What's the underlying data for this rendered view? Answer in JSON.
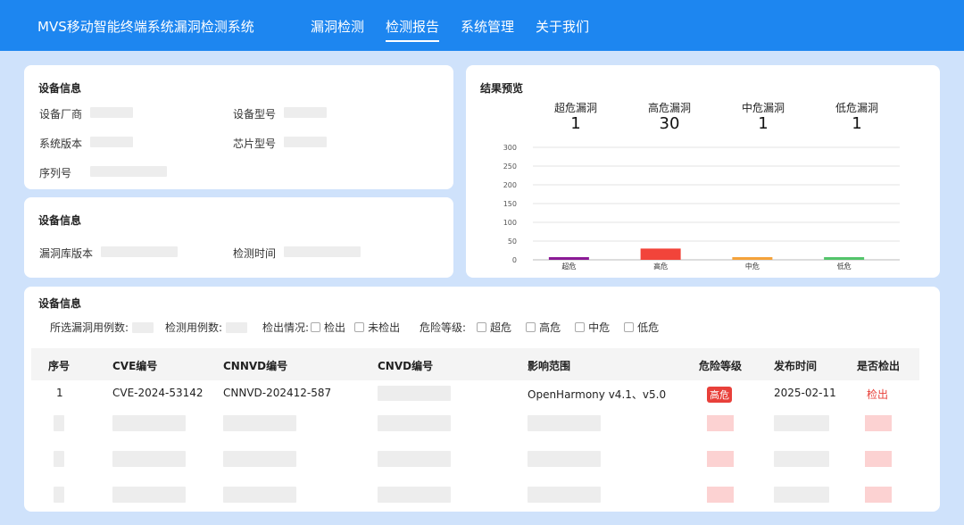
{
  "header": {
    "app_title": "MVS移动智能终端系统漏洞检测系统",
    "nav": [
      "漏洞检测",
      "检测报告",
      "系统管理",
      "关于我们"
    ],
    "active_nav": "检测报告"
  },
  "device_card": {
    "title": "设备信息",
    "manufacturer_label": "设备厂商",
    "model_label": "设备型号",
    "os_version_label": "系统版本",
    "chip_label": "芯片型号",
    "serial_label": "序列号"
  },
  "db_card": {
    "title": "设备信息",
    "db_version_label": "漏洞库版本",
    "detect_time_label": "检测时间"
  },
  "result_card": {
    "title": "结果预览",
    "stats": [
      {
        "label": "超危漏洞",
        "value": "1"
      },
      {
        "label": "高危漏洞",
        "value": "30"
      },
      {
        "label": "中危漏洞",
        "value": "1"
      },
      {
        "label": "低危漏洞",
        "value": "1"
      }
    ]
  },
  "chart_data": {
    "type": "bar",
    "categories": [
      "超危",
      "高危",
      "中危",
      "低危"
    ],
    "values": [
      1,
      30,
      1,
      1
    ],
    "ylim": [
      0,
      300
    ],
    "yticks": [
      "0",
      "50",
      "100",
      "150",
      "200",
      "250",
      "300"
    ],
    "ytick_values": [
      0,
      50,
      100,
      150,
      200,
      250,
      300
    ],
    "colors": [
      "#8b1a96",
      "#f2443a",
      "#f5a23a",
      "#53c46a"
    ],
    "grid": true,
    "xlabel": "",
    "ylabel": ""
  },
  "table_card": {
    "title": "设备信息",
    "filters": {
      "selected_cases_label": "所选漏洞用例数:",
      "detect_cases_label": "检测用例数:",
      "detect_status_label": "检出情况:",
      "status_options": [
        "检出",
        "未检出"
      ],
      "risk_level_label": "危险等级:",
      "risk_options": [
        "超危",
        "高危",
        "中危",
        "低危"
      ]
    },
    "columns": [
      "序号",
      "CVE编号",
      "CNNVD编号",
      "CNVD编号",
      "影响范围",
      "危险等级",
      "发布时间",
      "是否检出"
    ],
    "rows": [
      {
        "index": "1",
        "cve": "CVE-2024-53142",
        "cnnvd": "CNNVD-202412-587",
        "cnvd": "",
        "scope": "OpenHarmony v4.1、v5.0",
        "level": "高危",
        "date": "2025-02-11",
        "detected": "检出"
      }
    ]
  },
  "colors": {
    "primary": "#1d86f0",
    "background": "#cfe2fb",
    "danger": "#e8403a"
  }
}
